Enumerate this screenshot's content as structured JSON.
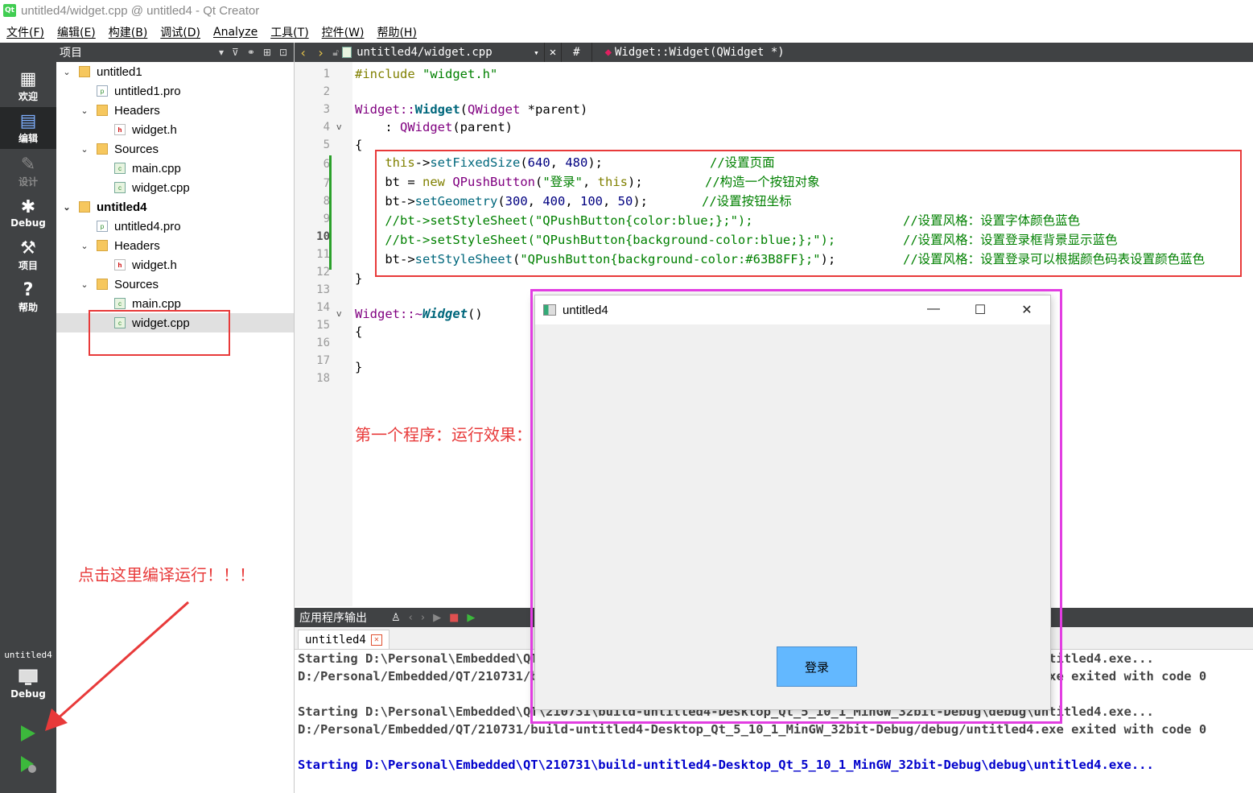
{
  "window": {
    "title": "untitled4/widget.cpp @ untitled4 - Qt Creator"
  },
  "menu": [
    "文件(F)",
    "编辑(E)",
    "构建(B)",
    "调试(D)",
    "Analyze",
    "工具(T)",
    "控件(W)",
    "帮助(H)"
  ],
  "modes": [
    {
      "label": "欢迎",
      "icon": "grid-icon"
    },
    {
      "label": "编辑",
      "icon": "edit-icon"
    },
    {
      "label": "设计",
      "icon": "pencil-icon"
    },
    {
      "label": "Debug",
      "icon": "bug-icon"
    },
    {
      "label": "项目",
      "icon": "wrench-icon"
    },
    {
      "label": "帮助",
      "icon": "help-icon"
    }
  ],
  "kit": {
    "project": "untitled4",
    "config": "Debug"
  },
  "project_panel": {
    "title": "项目",
    "tree": [
      {
        "label": "untitled1",
        "type": "project",
        "level": 0,
        "arrow": "v"
      },
      {
        "label": "untitled1.pro",
        "type": "pro",
        "level": 1,
        "arrow": ""
      },
      {
        "label": "Headers",
        "type": "folder",
        "level": 1,
        "arrow": "v"
      },
      {
        "label": "widget.h",
        "type": "h",
        "level": 2,
        "arrow": ""
      },
      {
        "label": "Sources",
        "type": "folder",
        "level": 1,
        "arrow": "v"
      },
      {
        "label": "main.cpp",
        "type": "cpp",
        "level": 2,
        "arrow": ""
      },
      {
        "label": "widget.cpp",
        "type": "cpp",
        "level": 2,
        "arrow": ""
      },
      {
        "label": "untitled4",
        "type": "project",
        "level": 0,
        "arrow": "v",
        "bold": true
      },
      {
        "label": "untitled4.pro",
        "type": "pro",
        "level": 1,
        "arrow": ""
      },
      {
        "label": "Headers",
        "type": "folder",
        "level": 1,
        "arrow": "v"
      },
      {
        "label": "widget.h",
        "type": "h",
        "level": 2,
        "arrow": ""
      },
      {
        "label": "Sources",
        "type": "folder",
        "level": 1,
        "arrow": "v"
      },
      {
        "label": "main.cpp",
        "type": "cpp",
        "level": 2,
        "arrow": ""
      },
      {
        "label": "widget.cpp",
        "type": "cpp",
        "level": 2,
        "arrow": "",
        "selected": true
      }
    ]
  },
  "editor": {
    "file": "untitled4/widget.cpp",
    "hash": "#",
    "symbol": "Widget::Widget(QWidget *)",
    "current_line": 10,
    "lines": [
      "1",
      "2",
      "3",
      "4",
      "5",
      "6",
      "7",
      "8",
      "9",
      "10",
      "11",
      "12",
      "13",
      "14",
      "15",
      "16",
      "17",
      "18"
    ],
    "code": {
      "l1_a": "#include ",
      "l1_b": "\"widget.h\"",
      "l3_a": "Widget::",
      "l3_b": "Widget",
      "l3_c": "(",
      "l3_d": "QWidget",
      "l3_e": " *parent)",
      "l4_a": "    : ",
      "l4_b": "QWidget",
      "l4_c": "(parent)",
      "l5": "{",
      "l6_a": "    this",
      "l6_b": "->",
      "l6_c": "setFixedSize",
      "l6_d": "(",
      "l6_e": "640",
      "l6_f": ", ",
      "l6_g": "480",
      "l6_h": ");",
      "l6_cmt": "//设置页面",
      "l7_a": "    bt = ",
      "l7_b": "new ",
      "l7_c": "QPushButton",
      "l7_d": "(",
      "l7_e": "\"登录\"",
      "l7_f": ", ",
      "l7_g": "this",
      "l7_h": ");",
      "l7_cmt": "//构造一个按钮对象",
      "l8_a": "    bt->",
      "l8_b": "setGeometry",
      "l8_c": "(",
      "l8_d": "300",
      "l8_e": ", ",
      "l8_f": "400",
      "l8_g": ", ",
      "l8_h": "100",
      "l8_i": ", ",
      "l8_j": "50",
      "l8_k": ");",
      "l8_cmt": "//设置按钮坐标",
      "l9": "    //bt->setStyleSheet(\"QPushButton{color:blue;};\");",
      "l9_cmt": "//设置风格：设置字体颜色蓝色",
      "l10": "    //bt->setStyleSheet(\"QPushButton{background-color:blue;};\");",
      "l10_cmt": "//设置风格：设置登录框背景显示蓝色",
      "l11_a": "    bt->",
      "l11_b": "setStyleSheet",
      "l11_c": "(",
      "l11_d": "\"QPushButton{background-color:#63B8FF};\"",
      "l11_e": ");",
      "l11_cmt": "//设置风格：设置登录可以根据颜色码表设置颜色蓝色",
      "l12": "}",
      "l14_a": "Widget::~",
      "l14_b": "Widget",
      "l14_c": "()",
      "l15": "{",
      "l17": "}"
    }
  },
  "annotations": {
    "run_hint": "点击这里编译运行！！！",
    "first_program": "第一个程序：运行效果："
  },
  "output": {
    "title": "应用程序输出",
    "tab": "untitled4",
    "lines": [
      "Starting D:\\Personal\\Embedded\\QT\\210731\\build-untitled4-Desktop_Qt_5_10_1_MinGW_32bit-Debug\\debug\\untitled4.exe...",
      "D:/Personal/Embedded/QT/210731/build-untitled4-Desktop_Qt_5_10_1_MinGW_32bit-Debug/debug/untitled4.exe exited with code 0",
      "",
      "Starting D:\\Personal\\Embedded\\QT\\210731\\build-untitled4-Desktop_Qt_5_10_1_MinGW_32bit-Debug\\debug\\untitled4.exe...",
      "D:/Personal/Embedded/QT/210731/build-untitled4-Desktop_Qt_5_10_1_MinGW_32bit-Debug/debug/untitled4.exe exited with code 0",
      "",
      "Starting D:\\Personal\\Embedded\\QT\\210731\\build-untitled4-Desktop_Qt_5_10_1_MinGW_32bit-Debug\\debug\\untitled4.exe..."
    ]
  },
  "app_window": {
    "title": "untitled4",
    "button_label": "登录",
    "button_color": "#63B8FF",
    "controls": [
      "—",
      "☐",
      "✕"
    ]
  },
  "colors": {
    "annotation_red": "#E83A3A",
    "highlight_magenta": "#E23EE2",
    "sidebar": "#404244"
  }
}
